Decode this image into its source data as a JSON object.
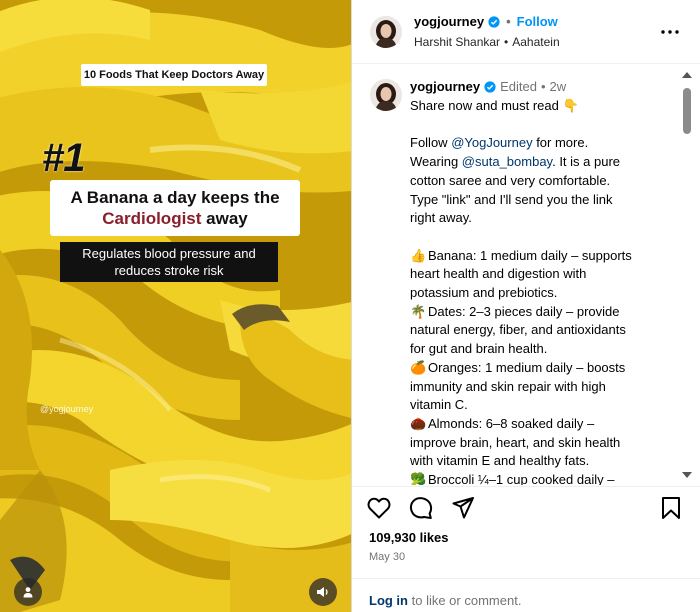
{
  "media": {
    "tag": "10 Foods That Keep Doctors Away",
    "number": "#1",
    "headline_line1": "A Banana a day keeps the",
    "headline_red": "Cardiologist",
    "headline_after": " away",
    "sub_line1": "Regulates blood pressure and",
    "sub_line2": "reduces stroke risk",
    "watermark": "@yogjourney"
  },
  "header": {
    "username": "yogjourney",
    "separator": "•",
    "follow_label": "Follow",
    "audio_artist": "Harshit Shankar",
    "audio_sep": "•",
    "audio_title": "Aahatein"
  },
  "caption": {
    "username": "yogjourney",
    "edited": "Edited",
    "sep": "•",
    "time": "2w",
    "lines": [
      {
        "text": "Share now and must read 👇"
      },
      {
        "blank": true
      },
      {
        "pre": "Follow ",
        "mention": "@YogJourney",
        "post": " for more."
      },
      {
        "pre": "Wearing ",
        "mention": "@suta_bombay",
        "post": ". It is a pure"
      },
      {
        "text": "cotton saree and very comfortable."
      },
      {
        "text": "Type \"link\" and I'll send you the link"
      },
      {
        "text": "right away."
      },
      {
        "blank": true
      },
      {
        "emoji": "👍",
        "text": "Banana: 1 medium daily – supports"
      },
      {
        "text": "heart health and digestion with"
      },
      {
        "text": "potassium and prebiotics."
      },
      {
        "emoji": "🌴",
        "text": "Dates: 2–3 pieces daily – provide"
      },
      {
        "text": "natural energy, fiber, and antioxidants"
      },
      {
        "text": "for gut and brain health."
      },
      {
        "emoji": "🍊",
        "text": "Oranges: 1 medium daily – boosts"
      },
      {
        "text": "immunity and skin repair with high"
      },
      {
        "text": "vitamin C."
      },
      {
        "emoji": "🌰",
        "text": "Almonds: 6–8 soaked daily –"
      },
      {
        "text": "improve brain, heart, and skin health"
      },
      {
        "text": "with vitamin E and healthy fats."
      },
      {
        "emoji": "🥦",
        "text": "Broccoli ¼–1 cup cooked daily –"
      }
    ]
  },
  "stats": {
    "likes": "109,930 likes",
    "date": "May 30"
  },
  "login": {
    "link": "Log in",
    "rest": " to like or comment."
  },
  "colors": {
    "link_blue": "#0095f6",
    "mention_blue": "#00376b",
    "muted": "#737373",
    "headline_red": "#8a1e2a"
  },
  "icons": [
    "verified-badge-icon",
    "more-options-icon",
    "heart-icon",
    "comment-icon",
    "share-icon",
    "bookmark-icon",
    "user-tag-icon",
    "volume-icon"
  ]
}
